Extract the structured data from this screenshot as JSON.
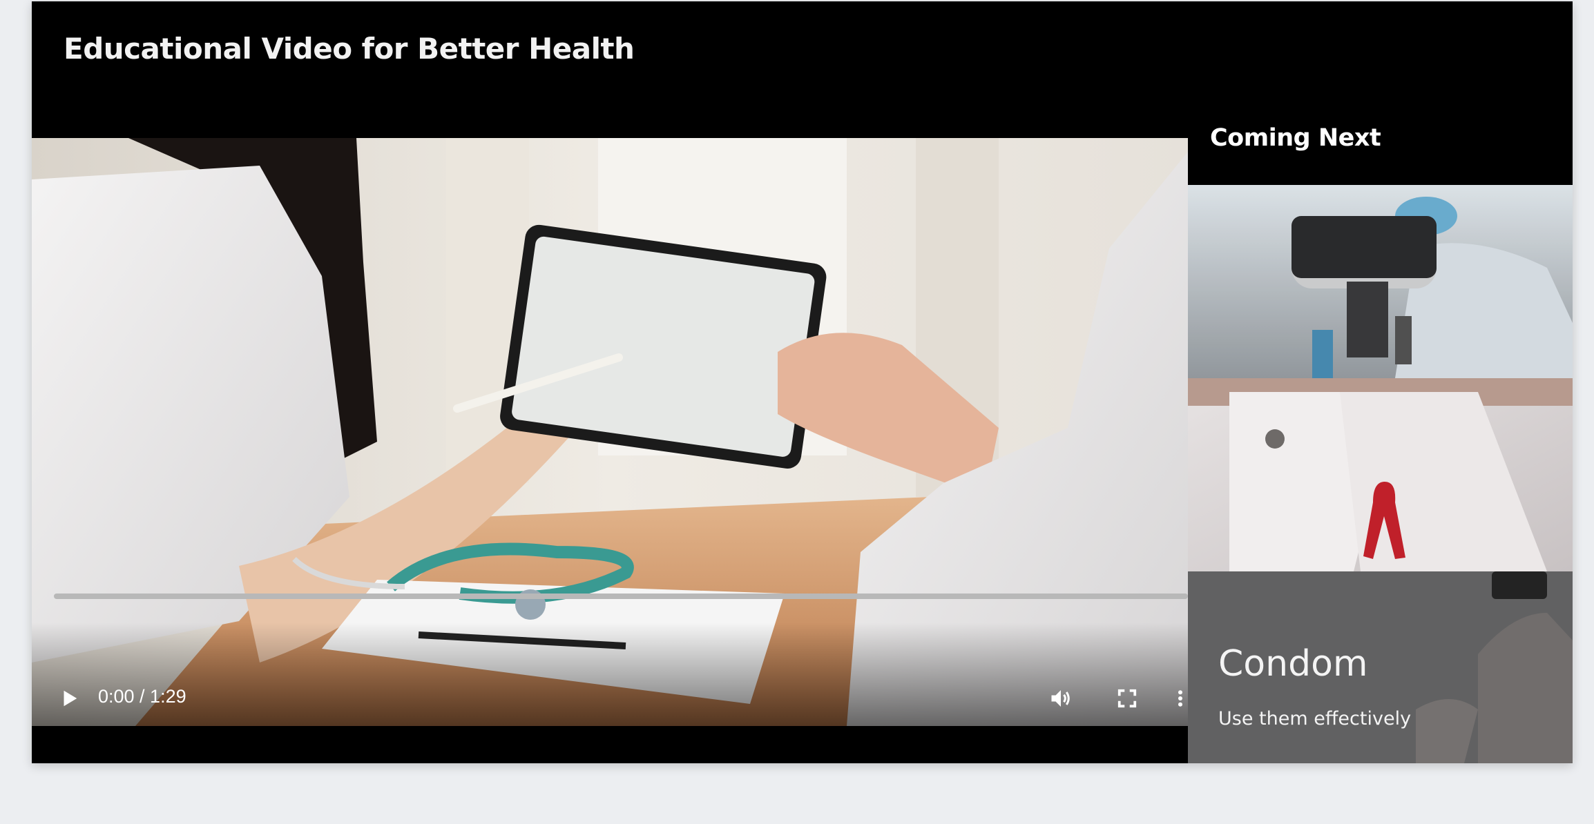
{
  "page": {
    "title": "Educational Video for Better Health"
  },
  "player": {
    "time_display": "0:00 / 1:29",
    "progress_fraction": 0,
    "play_icon": "play-icon",
    "volume_icon": "volume-icon",
    "fullscreen_icon": "fullscreen-icon",
    "more_icon": "more-vertical-icon"
  },
  "sidebar": {
    "heading": "Coming Next",
    "items": [
      {
        "image": "scientist-microscope"
      },
      {
        "image": "red-ribbon-shirt"
      },
      {
        "image": "couple-holding-fingers",
        "title": "Condom",
        "subtitle": "Use them effectively"
      }
    ]
  },
  "colors": {
    "background": "#eceef1",
    "card": "#000000",
    "text": "#ffffff",
    "ribbon": "#c0202a"
  }
}
